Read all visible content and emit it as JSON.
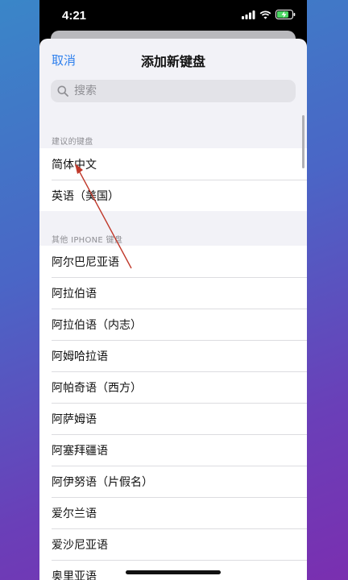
{
  "status_bar": {
    "time": "4:21"
  },
  "sheet": {
    "cancel_label": "取消",
    "title": "添加新键盘",
    "search_placeholder": "搜索"
  },
  "suggested": {
    "header": "建议的键盘",
    "items": [
      "简体中文",
      "英语（美国）"
    ]
  },
  "other": {
    "header": "其他 IPHONE 键盘",
    "items": [
      "阿尔巴尼亚语",
      "阿拉伯语",
      "阿拉伯语（内志）",
      "阿姆哈拉语",
      "阿帕奇语（西方）",
      "阿萨姆语",
      "阿塞拜疆语",
      "阿伊努语（片假名）",
      "爱尔兰语",
      "爱沙尼亚语",
      "奥里亚语"
    ]
  },
  "colors": {
    "accent": "#2f80ed",
    "annotation_arrow": "#c0392b"
  }
}
